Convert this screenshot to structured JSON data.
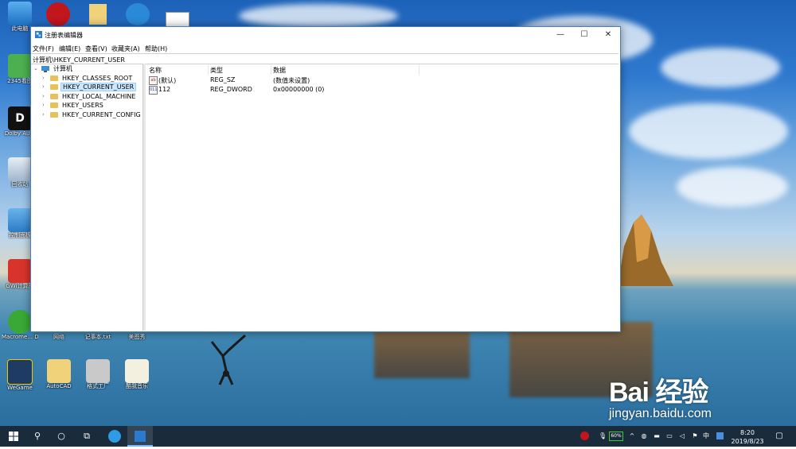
{
  "window": {
    "title": "注册表编辑器",
    "minimize": "—",
    "maximize": "☐",
    "close": "✕"
  },
  "menu": [
    "文件(F)",
    "编辑(E)",
    "查看(V)",
    "收藏夹(A)",
    "帮助(H)"
  ],
  "address": "计算机\\HKEY_CURRENT_USER",
  "tree": {
    "root": "计算机",
    "items": [
      {
        "label": "HKEY_CLASSES_ROOT",
        "selected": false
      },
      {
        "label": "HKEY_CURRENT_USER",
        "selected": true
      },
      {
        "label": "HKEY_LOCAL_MACHINE",
        "selected": false
      },
      {
        "label": "HKEY_USERS",
        "selected": false
      },
      {
        "label": "HKEY_CURRENT_CONFIG",
        "selected": false
      }
    ]
  },
  "list": {
    "headers": {
      "name": "名称",
      "type": "类型",
      "data": "数据"
    },
    "rows": [
      {
        "icon": "ab",
        "name": "(默认)",
        "type": "REG_SZ",
        "data": "(数值未设置)"
      },
      {
        "icon": "011",
        "name": "112",
        "type": "REG_DWORD",
        "data": "0x00000000 (0)"
      }
    ]
  },
  "desktop_icons": [
    {
      "label": "此电脑"
    },
    {
      "label": "2345看图"
    },
    {
      "label": "Dolby Au..."
    },
    {
      "label": "回收站"
    },
    {
      "label": "控制面板"
    },
    {
      "label": "GWi计算尺"
    },
    {
      "label": "Macrome... Dreamwe..."
    },
    {
      "label": "网络"
    },
    {
      "label": "记事本.txt"
    },
    {
      "label": "美图秀"
    },
    {
      "label": "WeGame"
    },
    {
      "label": "AutoCAD"
    },
    {
      "label": "格式工厂"
    },
    {
      "label": "酷我音乐"
    }
  ],
  "taskbar": {
    "battery": "60%",
    "ime": "中",
    "time": "8:20",
    "date": "2019/8/23"
  },
  "watermark": {
    "logo": "Bai 经验",
    "url": "jingyan.baidu.com"
  },
  "colors": {
    "accent": "#0078d7",
    "selection": "#cce8ff",
    "taskbar": "#1a2b3c"
  }
}
